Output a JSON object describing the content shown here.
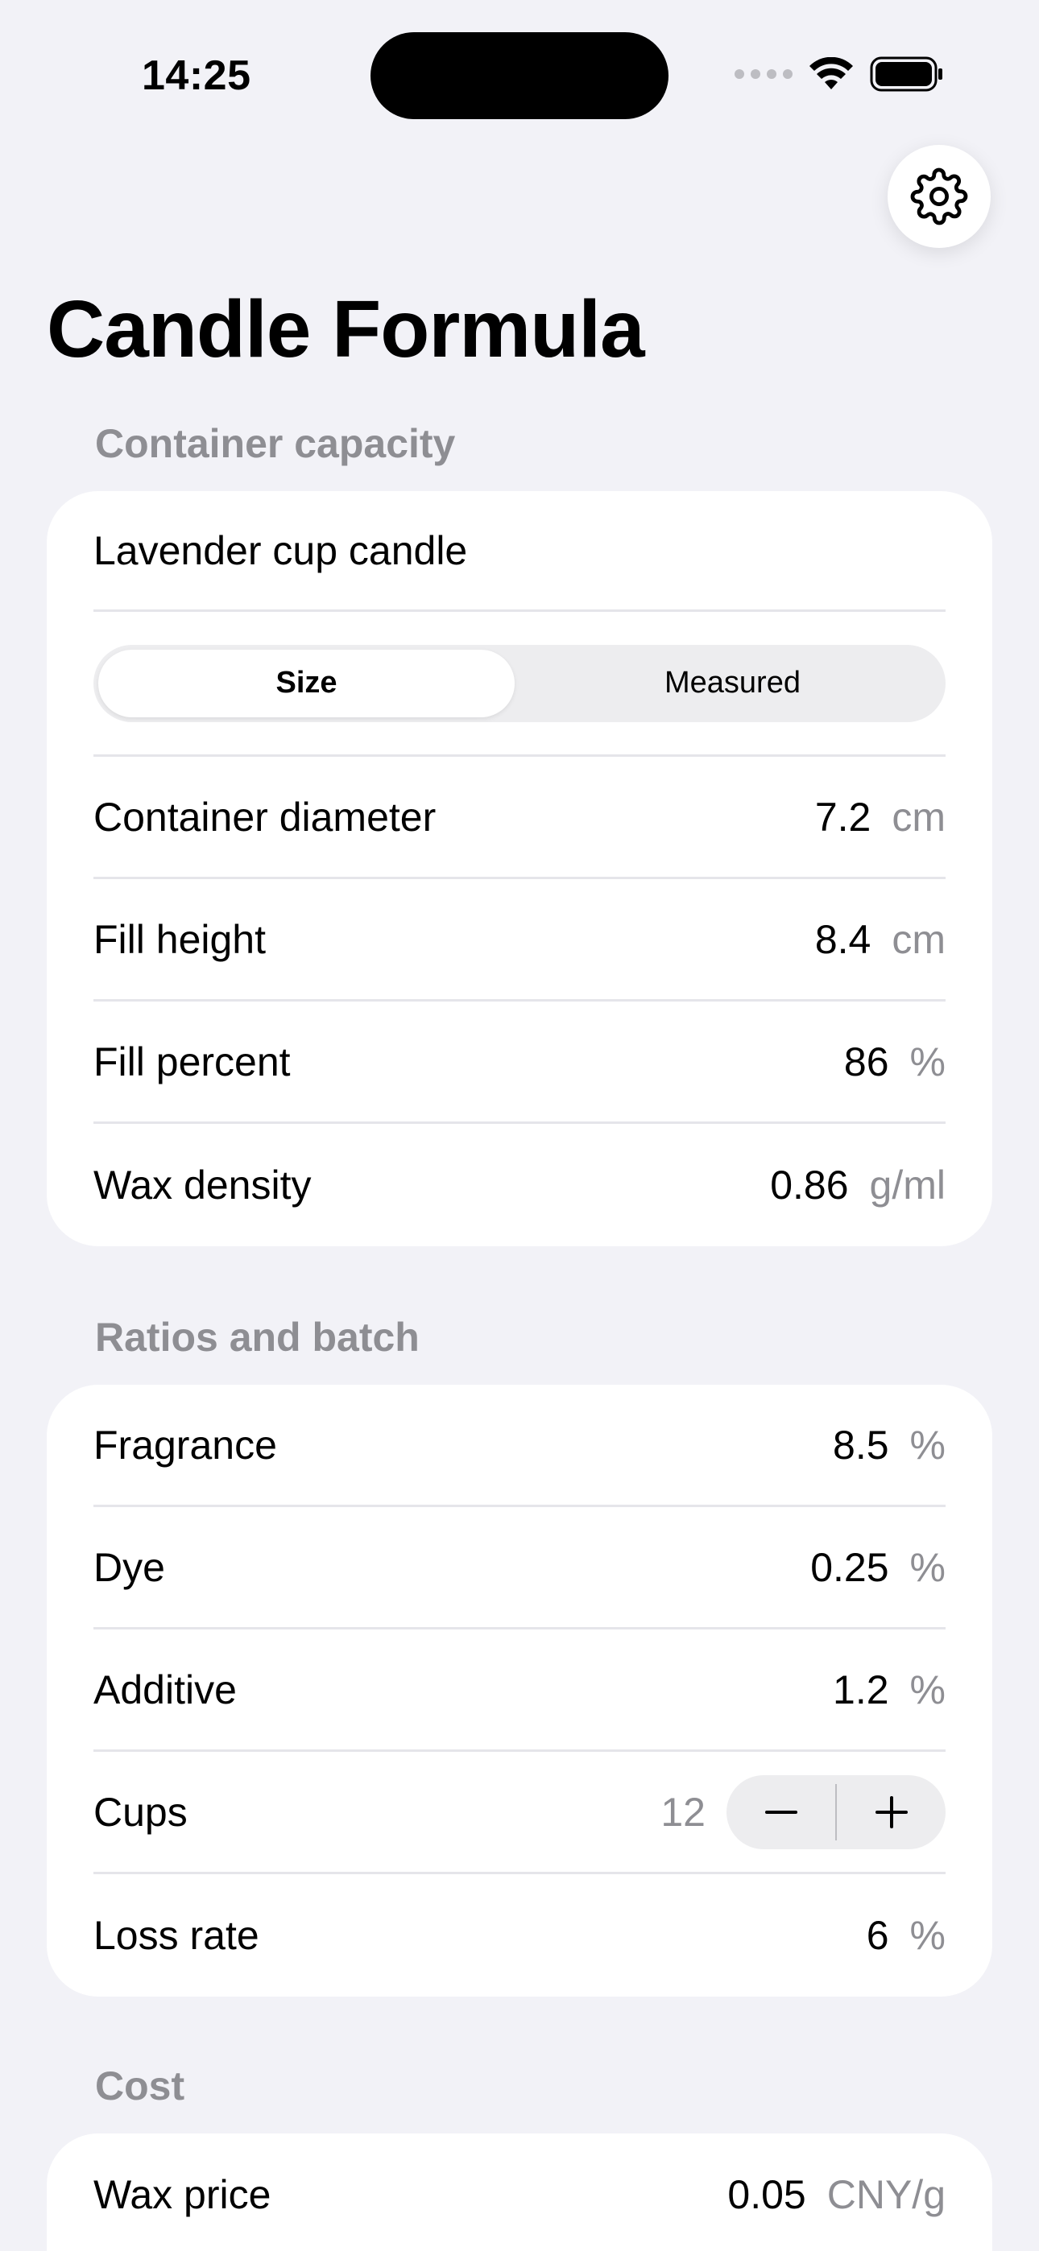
{
  "status_bar": {
    "time": "14:25"
  },
  "header": {
    "title": "Candle Formula",
    "settings_icon": "gear-icon"
  },
  "container_section": {
    "header": "Container capacity",
    "name": "Lavender cup candle",
    "segment": {
      "options": [
        "Size",
        "Measured"
      ],
      "selected": "Size"
    },
    "rows": [
      {
        "label": "Container diameter",
        "value": "7.2",
        "unit": "cm"
      },
      {
        "label": "Fill height",
        "value": "8.4",
        "unit": "cm"
      },
      {
        "label": "Fill percent",
        "value": "86",
        "unit": "%"
      },
      {
        "label": "Wax density",
        "value": "0.86",
        "unit": "g/ml"
      }
    ]
  },
  "ratios_section": {
    "header": "Ratios and batch",
    "fragrance": {
      "label": "Fragrance",
      "value": "8.5",
      "unit": "%"
    },
    "dye": {
      "label": "Dye",
      "value": "0.25",
      "unit": "%"
    },
    "additive": {
      "label": "Additive",
      "value": "1.2",
      "unit": "%"
    },
    "cups": {
      "label": "Cups",
      "value": "12"
    },
    "loss_rate": {
      "label": "Loss rate",
      "value": "6",
      "unit": "%"
    }
  },
  "cost_section": {
    "header": "Cost",
    "wax_price": {
      "label": "Wax price",
      "value": "0.05",
      "unit": "CNY/g"
    }
  }
}
